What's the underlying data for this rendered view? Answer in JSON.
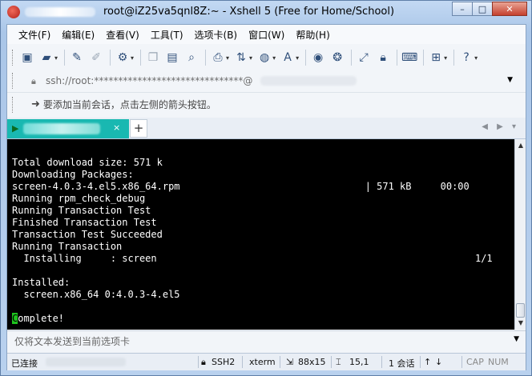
{
  "window": {
    "title": "root@iZ25va5qnl8Z:~ - Xshell 5 (Free for Home/School)",
    "buttons": {
      "minimize": "–",
      "maximize": "□",
      "close": "✕"
    }
  },
  "menu": [
    {
      "label": "文件(F)"
    },
    {
      "label": "编辑(E)"
    },
    {
      "label": "查看(V)"
    },
    {
      "label": "工具(T)"
    },
    {
      "label": "选项卡(B)"
    },
    {
      "label": "窗口(W)"
    },
    {
      "label": "帮助(H)"
    }
  ],
  "address": {
    "text": "ssh://root:*******************************@"
  },
  "hint": {
    "text": "要添加当前会话，点击左侧的箭头按钮。"
  },
  "tabs": {
    "add_label": "+",
    "close_label": "×",
    "nav_label": "◀ ▶ ▾"
  },
  "terminal": {
    "lines": [
      "Total download size: 571 k",
      "Downloading Packages:",
      "screen-4.0.3-4.el5.x86_64.rpm                                | 571 kB     00:00",
      "Running rpm_check_debug",
      "Running Transaction Test",
      "Finished Transaction Test",
      "Transaction Test Succeeded",
      "Running Transaction",
      "  Installing     : screen                                                       1/1",
      "",
      "Installed:",
      "  screen.x86_64 0:4.0.3-4.el5",
      "",
      "omplete!"
    ],
    "cursor_char": "C"
  },
  "sendbar": {
    "placeholder": "仅将文本发送到当前选项卡"
  },
  "status": {
    "connected": "已连接",
    "protocol": "SSH2",
    "terminal_type": "xterm",
    "size": "88x15",
    "position": "15,1",
    "sessions": "1 会话",
    "cap": "CAP",
    "num": "NUM"
  },
  "colors": {
    "tab_accent": "#19b8b1",
    "terminal_bg": "#000000",
    "cursor": "#1ec31e"
  }
}
